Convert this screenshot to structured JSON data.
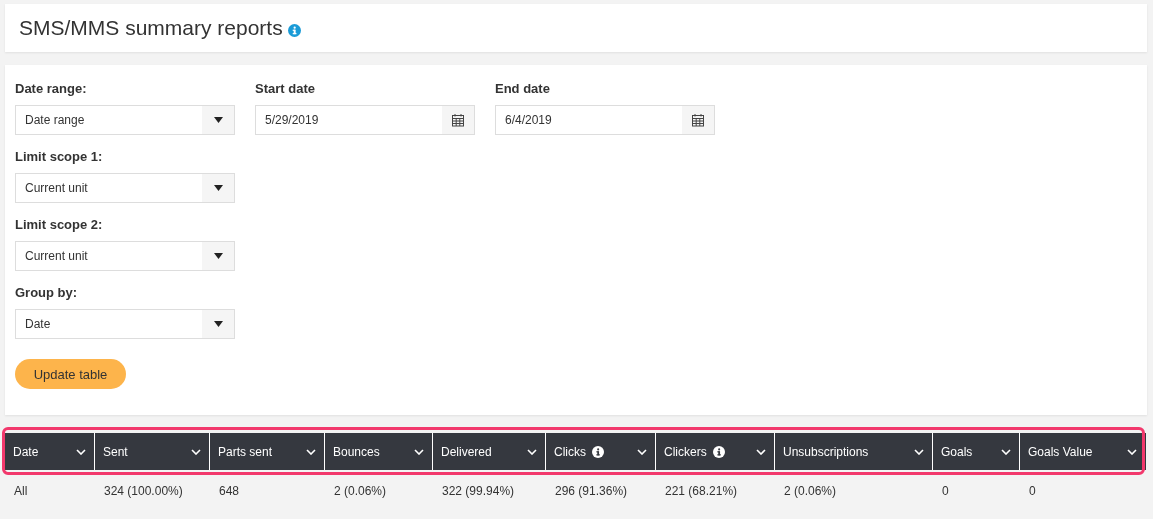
{
  "header": {
    "title": "SMS/MMS summary reports"
  },
  "filters": {
    "rows": [
      [
        {
          "label": "Date range:",
          "kind": "select",
          "value": "Date range"
        },
        {
          "label": "Start date",
          "kind": "date",
          "value": "5/29/2019"
        },
        {
          "label": "End date",
          "kind": "date",
          "value": "6/4/2019"
        }
      ],
      [
        {
          "label": "Limit scope 1:",
          "kind": "select",
          "value": "Current unit"
        }
      ],
      [
        {
          "label": "Limit scope 2:",
          "kind": "select",
          "value": "Current unit"
        }
      ],
      [
        {
          "label": "Group by:",
          "kind": "select",
          "value": "Date"
        }
      ]
    ],
    "button": "Update table"
  },
  "table": {
    "highlighted": true,
    "columns": [
      {
        "label": "Date",
        "info": false
      },
      {
        "label": "Sent",
        "info": false
      },
      {
        "label": "Parts sent",
        "info": false
      },
      {
        "label": "Bounces",
        "info": false
      },
      {
        "label": "Delivered",
        "info": false
      },
      {
        "label": "Clicks",
        "info": true
      },
      {
        "label": "Clickers",
        "info": true
      },
      {
        "label": "Unsubscriptions",
        "info": false
      },
      {
        "label": "Goals",
        "info": false
      },
      {
        "label": "Goals Value",
        "info": false
      }
    ],
    "rows": [
      [
        "All",
        "324 (100.00%)",
        "648",
        "2 (0.06%)",
        "322 (99.94%)",
        "296 (91.36%)",
        "221 (68.21%)",
        "2 (0.06%)",
        "0",
        "0"
      ]
    ]
  }
}
